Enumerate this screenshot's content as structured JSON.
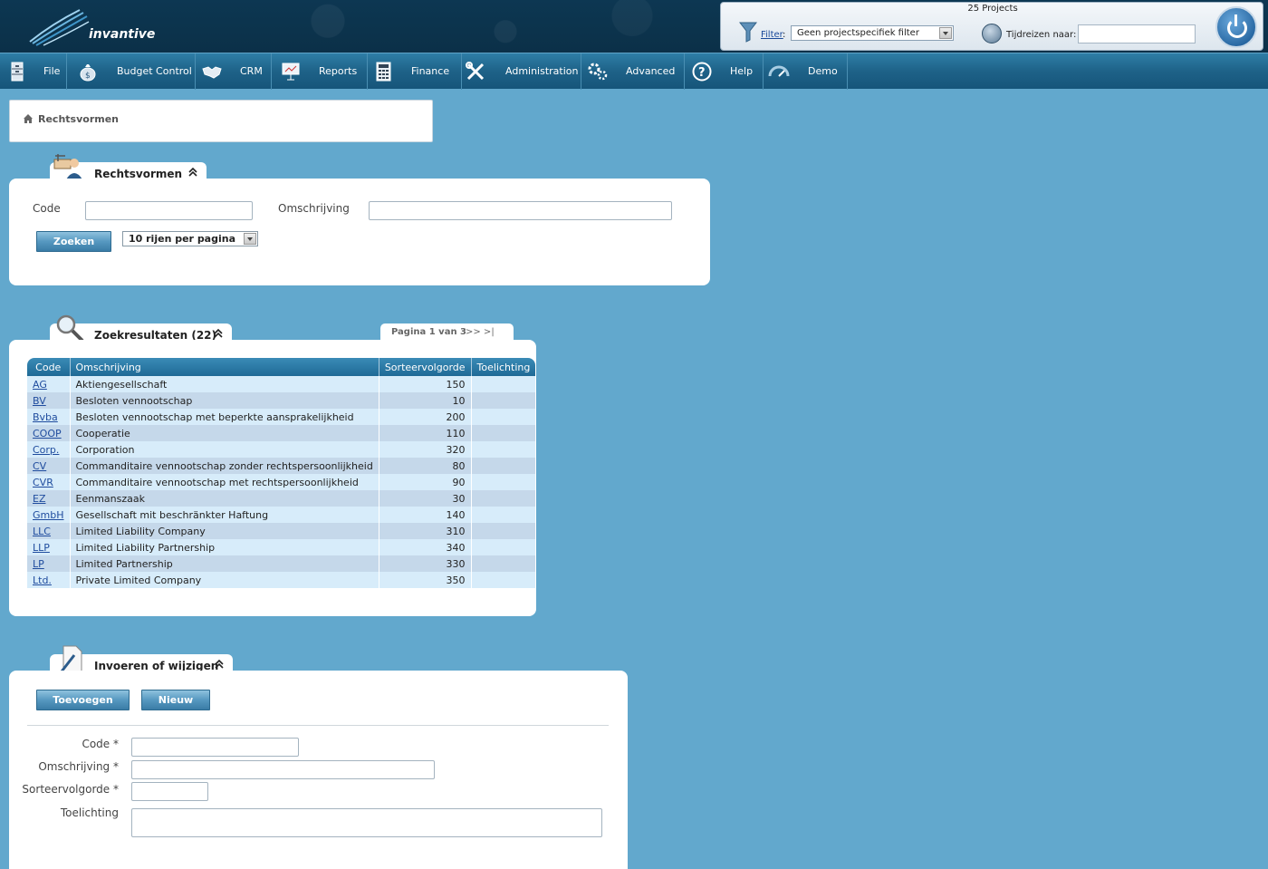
{
  "header": {
    "logo_text": "invantive",
    "projects_count": "25 Projects",
    "filter_link": "Filter",
    "filter_colon": ":",
    "filter_value": "Geen projectspecifiek filter",
    "time_travel_label": "Tijdreizen naar:",
    "time_travel_value": ""
  },
  "nav": {
    "items": [
      {
        "label": "File",
        "icon": "file-cabinet-icon"
      },
      {
        "label": "Budget Control",
        "icon": "money-bag-icon"
      },
      {
        "label": "CRM",
        "icon": "handshake-icon"
      },
      {
        "label": "Reports",
        "icon": "presentation-icon"
      },
      {
        "label": "Finance",
        "icon": "calculator-icon"
      },
      {
        "label": "Administration",
        "icon": "tools-icon"
      },
      {
        "label": "Advanced",
        "icon": "gears-icon"
      },
      {
        "label": "Help",
        "icon": "question-icon"
      },
      {
        "label": "Demo",
        "icon": "gauge-icon"
      }
    ]
  },
  "breadcrumb": {
    "label": "Rechtsvormen"
  },
  "search_panel": {
    "title": "Rechtsvormen",
    "code_label": "Code",
    "code_value": "",
    "omschrijving_label": "Omschrijving",
    "omschrijving_value": "",
    "search_button": "Zoeken",
    "rows_select": "10 rijen per pagina"
  },
  "results_panel": {
    "title": "Zoekresultaten (22)",
    "paging_label": "Pagina 1 van 3",
    "paging_next": ">> >|",
    "columns": [
      "Code",
      "Omschrijving",
      "Sorteervolgorde",
      "Toelichting"
    ],
    "rows": [
      {
        "code": "AG",
        "omschrijving": "Aktiengesellschaft",
        "sort": "150",
        "toelichting": ""
      },
      {
        "code": "BV",
        "omschrijving": "Besloten vennootschap",
        "sort": "10",
        "toelichting": ""
      },
      {
        "code": "Bvba",
        "omschrijving": "Besloten vennootschap met beperkte aansprakelijkheid",
        "sort": "200",
        "toelichting": ""
      },
      {
        "code": "COOP",
        "omschrijving": "Cooperatie",
        "sort": "110",
        "toelichting": ""
      },
      {
        "code": "Corp.",
        "omschrijving": "Corporation",
        "sort": "320",
        "toelichting": ""
      },
      {
        "code": "CV",
        "omschrijving": "Commanditaire vennootschap zonder rechtspersoonlijkheid",
        "sort": "80",
        "toelichting": ""
      },
      {
        "code": "CVR",
        "omschrijving": "Commanditaire vennootschap met rechtspersoonlijkheid",
        "sort": "90",
        "toelichting": ""
      },
      {
        "code": "EZ",
        "omschrijving": "Eenmanszaak",
        "sort": "30",
        "toelichting": ""
      },
      {
        "code": "GmbH",
        "omschrijving": "Gesellschaft mit beschränkter Haftung",
        "sort": "140",
        "toelichting": ""
      },
      {
        "code": "LLC",
        "omschrijving": "Limited Liability Company",
        "sort": "310",
        "toelichting": ""
      },
      {
        "code": "LLP",
        "omschrijving": "Limited Liability Partnership",
        "sort": "340",
        "toelichting": ""
      },
      {
        "code": "LP",
        "omschrijving": "Limited Partnership",
        "sort": "330",
        "toelichting": ""
      },
      {
        "code": "Ltd.",
        "omschrijving": "Private Limited Company",
        "sort": "350",
        "toelichting": ""
      }
    ]
  },
  "edit_panel": {
    "title": "Invoeren of wijzigen",
    "add_button": "Toevoegen",
    "new_button": "Nieuw",
    "code_label": "Code *",
    "omschrijving_label": "Omschrijving *",
    "sort_label": "Sorteervolgorde *",
    "toelichting_label": "Toelichting"
  }
}
